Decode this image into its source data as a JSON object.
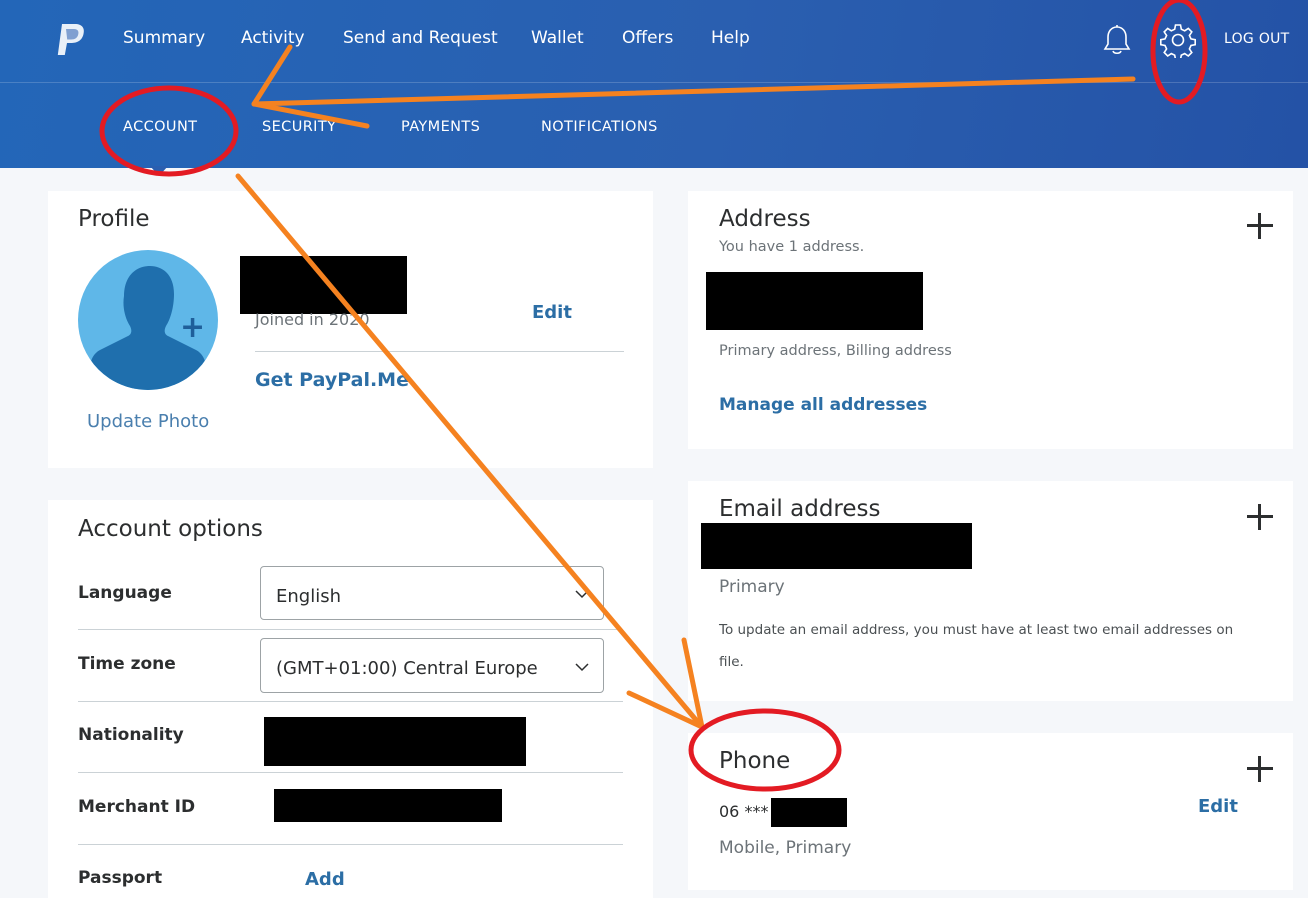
{
  "header": {
    "nav": [
      "Summary",
      "Activity",
      "Send and Request",
      "Wallet",
      "Offers",
      "Help"
    ],
    "logout_label": "LOG OUT",
    "subnav": [
      "ACCOUNT",
      "SECURITY",
      "PAYMENTS",
      "NOTIFICATIONS"
    ],
    "icons": {
      "logo": "paypal-logo",
      "bell": "bell-icon",
      "gear": "gear-icon"
    }
  },
  "profile": {
    "title": "Profile",
    "joined": "Joined in 2020",
    "edit_label": "Edit",
    "paypalme_label": "Get PayPal.Me",
    "update_photo_label": "Update Photo",
    "avatar_plus": "+"
  },
  "account_options": {
    "title": "Account options",
    "language_label": "Language",
    "language_value": "English",
    "timezone_label": "Time zone",
    "timezone_value": "(GMT+01:00) Central Europe",
    "nationality_label": "Nationality",
    "merchant_label": "Merchant ID",
    "passport_label": "Passport",
    "passport_add": "Add"
  },
  "address": {
    "title": "Address",
    "count_text": "You have 1 address.",
    "type_text": "Primary address, Billing address",
    "manage_label": "Manage all addresses"
  },
  "email": {
    "title": "Email address",
    "type_text": "Primary",
    "note_line1": "To update an email address, you must have at least two email addresses on",
    "note_line2": "file."
  },
  "phone": {
    "title": "Phone",
    "number_prefix": "06 ***",
    "type_text": "Mobile, Primary",
    "edit_label": "Edit"
  },
  "colors": {
    "header_blue": "#2a5fb0",
    "link_blue": "#2c6ea5",
    "annotation_orange": "#f58220",
    "annotation_red": "#e31b23"
  }
}
